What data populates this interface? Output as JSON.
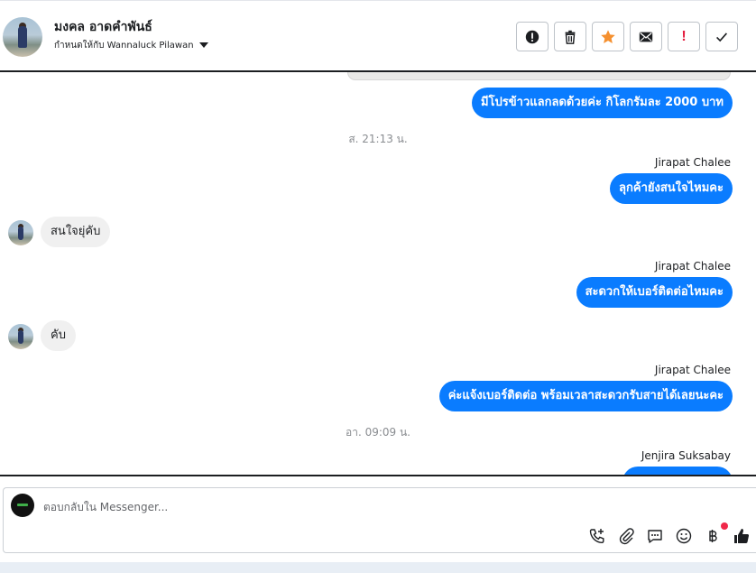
{
  "header": {
    "contact_name": "มงคล อาดคำพันธ์",
    "assigned_to": "กำหนดให้กับ Wannaluck Pilawan"
  },
  "messages": {
    "m1": "มีโปรข้าวแลกลดด้วยค่ะ กิโลกรัมละ 2000 บาท",
    "ts1": "ส. 21:13 น.",
    "sender1": "Jirapat Chalee",
    "m2": "ลุกค้ายังสนใจไหมคะ",
    "m3": "สนใจยุ่คับ",
    "sender2": "Jirapat Chalee",
    "m4": "สะดวกให้เบอร์ติดต่อไหมคะ",
    "m5": "คับ",
    "sender3": "Jirapat Chalee",
    "m6": "ค่ะแจ้งเบอร์ติดต่อ พร้อมเวลาสะดวกรับสายได้เลยนะคะ",
    "ts2": "อา. 09:09 น.",
    "sender4": "Jenjira Suksabay"
  },
  "composer": {
    "placeholder": "ตอบกลับใน Messenger..."
  },
  "colors": {
    "outgoing_bubble": "#0a7cff",
    "incoming_bubble": "#f0f0f0",
    "star": "#f5902f",
    "alert": "#e41e3f"
  }
}
